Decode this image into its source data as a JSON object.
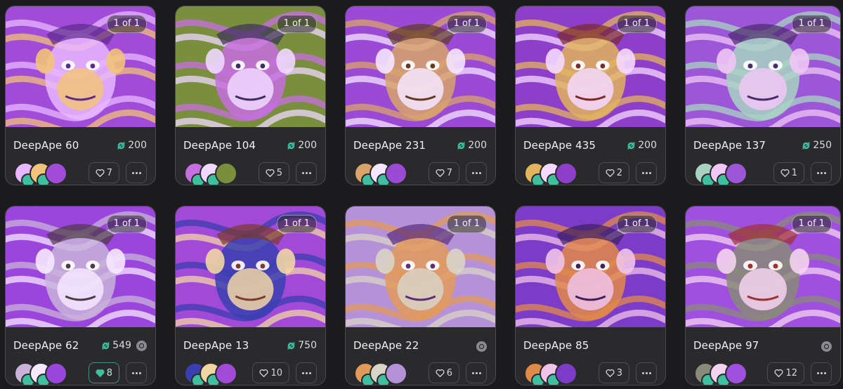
{
  "accent_color": "#3fbf9f",
  "cards": [
    {
      "name": "DeepApe 60",
      "edition": "1 of 1",
      "price": "200",
      "likes": "7",
      "liked": false,
      "verified": false,
      "palette": [
        "#a04cd8",
        "#e9b7ff",
        "#f2c37a",
        "#5b2a8a"
      ]
    },
    {
      "name": "DeepApe 104",
      "edition": "1 of 1",
      "price": "200",
      "likes": "5",
      "liked": false,
      "verified": false,
      "palette": [
        "#7a8f3e",
        "#c76fe0",
        "#f0d8ff",
        "#3a2f5a"
      ]
    },
    {
      "name": "DeepApe 231",
      "edition": "1 of 1",
      "price": "200",
      "likes": "7",
      "liked": false,
      "verified": false,
      "palette": [
        "#9b4ad6",
        "#d8a46a",
        "#f4e6ff",
        "#5d3a20"
      ]
    },
    {
      "name": "DeepApe 435",
      "edition": "1 of 1",
      "price": "200",
      "likes": "2",
      "liked": false,
      "verified": false,
      "palette": [
        "#8e3fc9",
        "#e2b45e",
        "#f5d9ff",
        "#7a2a2a"
      ]
    },
    {
      "name": "DeepApe 137",
      "edition": "1 of 1",
      "price": "250",
      "likes": "1",
      "liked": false,
      "verified": false,
      "palette": [
        "#9c57d8",
        "#a8d3c2",
        "#f0c7f5",
        "#4a2a6b"
      ]
    },
    {
      "name": "DeepApe 62",
      "edition": "1 of 1",
      "price": "549",
      "likes": "8",
      "liked": true,
      "verified": true,
      "palette": [
        "#9a45dc",
        "#c9b3d9",
        "#f6e8ff",
        "#4c3a45"
      ]
    },
    {
      "name": "DeepApe 13",
      "edition": "1 of 1",
      "price": "750",
      "likes": "10",
      "liked": false,
      "verified": false,
      "palette": [
        "#a24ad8",
        "#3a3fb0",
        "#f1d6a4",
        "#7a3b28"
      ]
    },
    {
      "name": "DeepApe 22",
      "edition": "1 of 1",
      "price": "",
      "likes": "6",
      "liked": false,
      "verified": true,
      "palette": [
        "#b592d8",
        "#e29a5a",
        "#d9d4c6",
        "#5a2c7a"
      ]
    },
    {
      "name": "DeepApe 85",
      "edition": "1 of 1",
      "price": "",
      "likes": "3",
      "liked": false,
      "verified": false,
      "palette": [
        "#7d3cc7",
        "#e08a4a",
        "#f0c3e8",
        "#3c2060"
      ]
    },
    {
      "name": "DeepApe 97",
      "edition": "1 of 1",
      "price": "",
      "likes": "12",
      "liked": false,
      "verified": true,
      "palette": [
        "#9f50de",
        "#8a8a7a",
        "#f4d3f0",
        "#a03030"
      ]
    }
  ]
}
